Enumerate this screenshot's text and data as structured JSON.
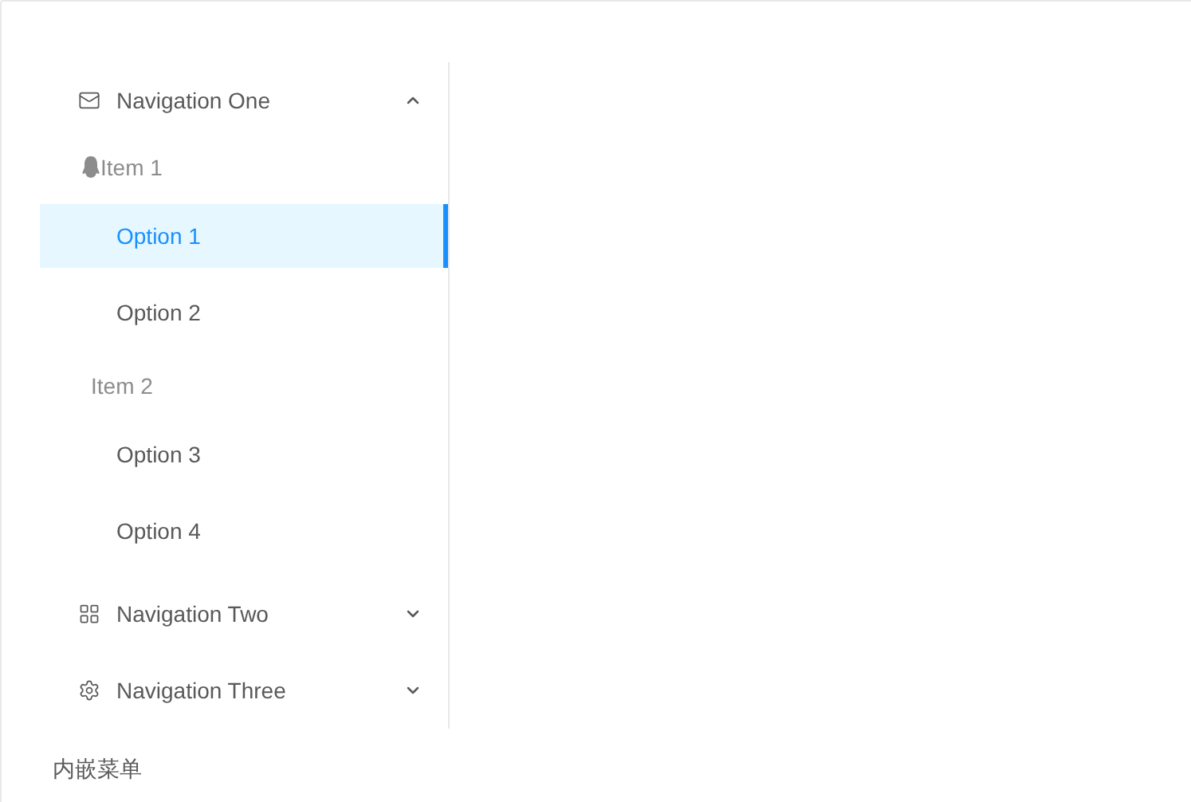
{
  "menu": [
    {
      "label": "Navigation One",
      "expanded": true,
      "groups": [
        {
          "title": "Item 1",
          "options": [
            {
              "label": "Option 1",
              "selected": true
            },
            {
              "label": "Option 2",
              "selected": false
            }
          ]
        },
        {
          "title": "Item 2",
          "options": [
            {
              "label": "Option 3",
              "selected": false
            },
            {
              "label": "Option 4",
              "selected": false
            }
          ]
        }
      ]
    },
    {
      "label": "Navigation Two",
      "expanded": false
    },
    {
      "label": "Navigation Three",
      "expanded": false
    }
  ],
  "footer_title": "内嵌菜单"
}
